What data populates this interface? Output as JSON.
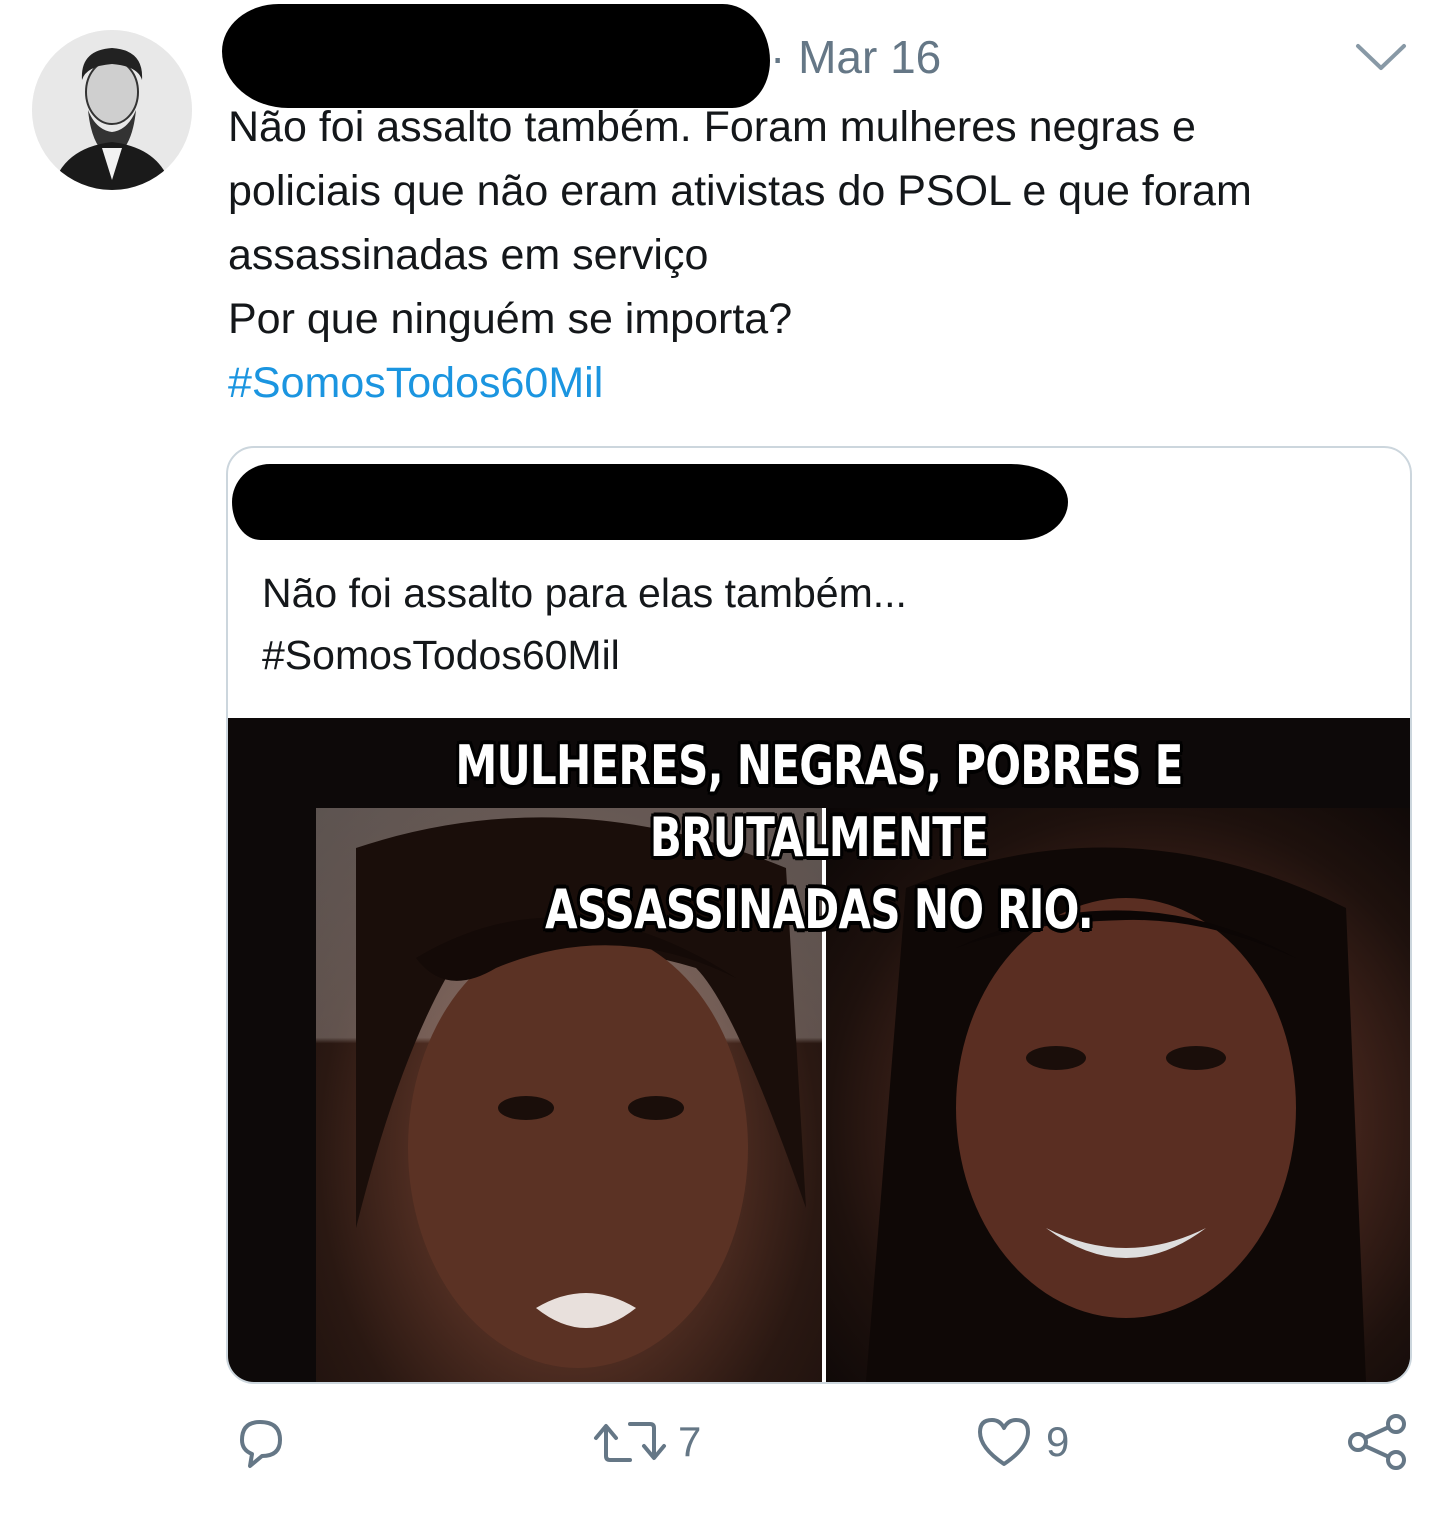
{
  "tweet": {
    "timestamp": "· Mar 16",
    "text_lines": [
      "Não foi assalto também. Foram mulheres negras e",
      "policiais que não eram ativistas do PSOL e  que foram",
      "assassinadas em serviço",
      "Por que ninguém se importa?"
    ],
    "hashtag": "#SomosTodos60Mil"
  },
  "quoted_tweet": {
    "text_lines": [
      "Não foi assalto para elas também...",
      "#SomosTodos60Mil"
    ],
    "image": {
      "caption_lines": [
        "MULHERES, NEGRAS, POBRES E BRUTALMENTE",
        "ASSASSINADAS NO RIO."
      ]
    }
  },
  "actions": {
    "reply_count": "",
    "retweet_count": "7",
    "like_count": "9"
  },
  "icons": {
    "more": "chevron-down-icon",
    "reply": "reply-icon",
    "retweet": "retweet-icon",
    "like": "heart-icon",
    "share": "share-icon"
  },
  "colors": {
    "hashtag": "#1b95e0",
    "secondary_text": "#657786",
    "border": "#ccd6dd"
  }
}
